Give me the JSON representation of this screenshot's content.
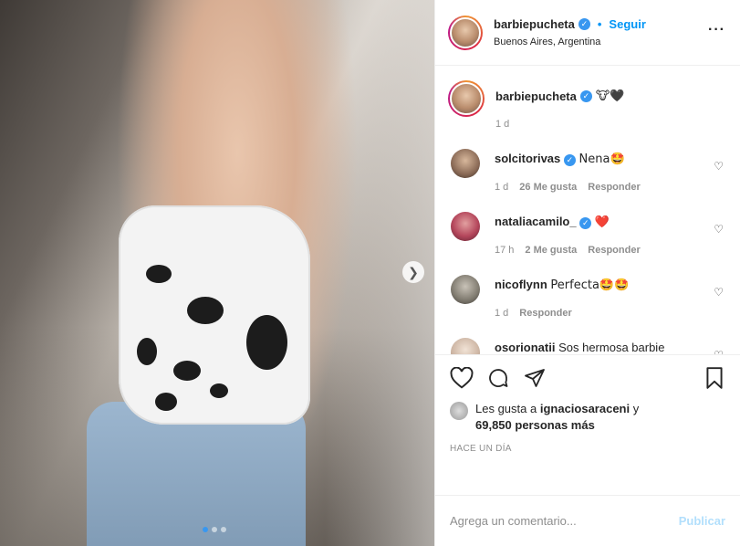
{
  "post": {
    "username": "barbiepucheta",
    "follow_label": "Seguir",
    "location": "Buenos Aires, Argentina",
    "caption_emoji": "🐮🖤",
    "caption_age": "1 d",
    "carousel_dots": 3,
    "carousel_active": 0
  },
  "comments": [
    {
      "user": "solcitorivas",
      "verified": true,
      "text": "Nena🤩",
      "age": "1 d",
      "likes": "26 Me gusta",
      "reply": "Responder"
    },
    {
      "user": "nataliacamilo_",
      "verified": true,
      "text": "❤️",
      "age": "17 h",
      "likes": "2 Me gusta",
      "reply": "Responder"
    },
    {
      "user": "nicoflynn",
      "verified": false,
      "text": "Perfecta🤩🤩",
      "age": "1 d",
      "likes": "",
      "reply": "Responder"
    },
    {
      "user": "osorionatii",
      "verified": false,
      "text": "Sos hermosa barbie",
      "text2": "❤️❤️",
      "age": "",
      "likes": "",
      "reply": ""
    }
  ],
  "likes": {
    "prefix": "Les gusta a",
    "user": "ignaciosaraceni",
    "conj": "y",
    "count": "69,850 personas más"
  },
  "date": "HACE UN DÍA",
  "add_comment": {
    "placeholder": "Agrega un comentario...",
    "publish": "Publicar"
  },
  "colors": {
    "accent": "#0095f6",
    "verified": "#3897f0",
    "muted": "#8e8e8e",
    "publish_disabled": "#b2dffc"
  }
}
